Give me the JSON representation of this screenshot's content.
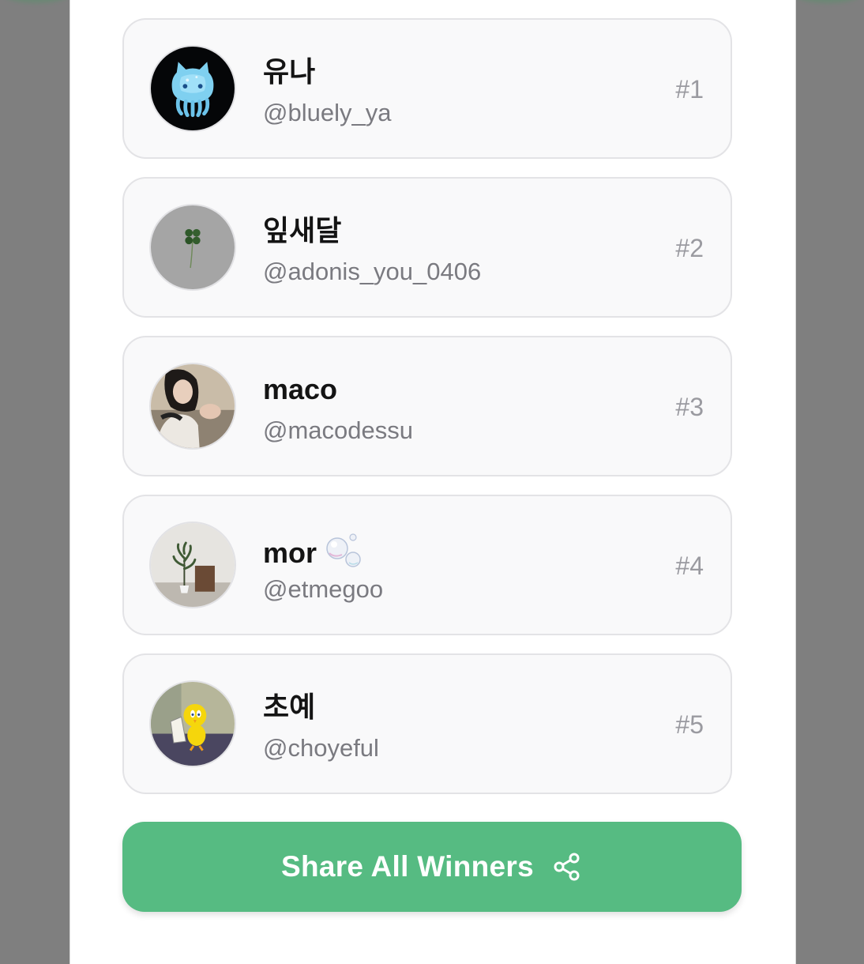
{
  "winners": [
    {
      "name": "유나",
      "handle": "@bluely_ya",
      "rank": "#1",
      "avatar_icon": "blue-jelly-cat-icon"
    },
    {
      "name": "잎새달",
      "handle": "@adonis_you_0406",
      "rank": "#2",
      "avatar_icon": "four-leaf-clover-icon"
    },
    {
      "name": "maco",
      "handle": "@macodessu",
      "rank": "#3",
      "avatar_icon": "person-photo-icon"
    },
    {
      "name": "mor",
      "handle": "@etmegoo",
      "rank": "#4",
      "avatar_icon": "plant-photo-icon",
      "emoji_icon": "bubbles-icon"
    },
    {
      "name": "초예",
      "handle": "@choyeful",
      "rank": "#5",
      "avatar_icon": "yellow-bird-cartoon-icon"
    }
  ],
  "share_button": {
    "label": "Share All Winners",
    "icon": "share-icon"
  },
  "colors": {
    "accent": "#56bb82",
    "card_bg": "#f9f9fa",
    "card_border": "#e3e3e6",
    "backdrop": "#7f7f7f"
  }
}
